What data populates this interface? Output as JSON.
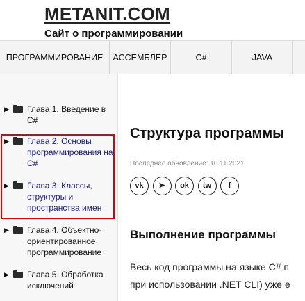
{
  "header": {
    "site_title": "METANIT.COM",
    "tagline": "Сайт о программировании"
  },
  "nav": {
    "items": [
      {
        "label": "ПРОГРАММИРОВАНИЕ"
      },
      {
        "label": "АССЕМБЛЕР"
      },
      {
        "label": "C#"
      },
      {
        "label": "JAVA"
      },
      {
        "label": ""
      }
    ]
  },
  "sidebar": {
    "chapters": [
      {
        "label": "Глава 1. Введение в C#"
      },
      {
        "label": "Глава 2. Основы программирования на C#"
      },
      {
        "label": "Глава 3. Классы, структуры и пространства имен"
      },
      {
        "label": "Глава 4. Объектно-ориентированное программирование"
      },
      {
        "label": "Глава 5. Обработка исключений"
      }
    ]
  },
  "main": {
    "title": "Структура программы",
    "updated": "Последнее обновление: 10.11.2021",
    "social": [
      {
        "icon": "vk-icon",
        "glyph": "vk"
      },
      {
        "icon": "telegram-icon",
        "glyph": "➤"
      },
      {
        "icon": "odnoklassniki-icon",
        "glyph": "ok"
      },
      {
        "icon": "twitter-icon",
        "glyph": "tw"
      },
      {
        "icon": "facebook-icon",
        "glyph": "f"
      }
    ],
    "section_title": "Выполнение программы",
    "paragraph_line1": "Весь код программы на языке C# п",
    "paragraph_line2": "при использовании .NET CLI) уже е"
  },
  "colors": {
    "highlight": "#e00000",
    "link": "#1a1a8c",
    "nav_bg": "#f3f3f3",
    "sidebar_bg": "#f7f7f7"
  }
}
